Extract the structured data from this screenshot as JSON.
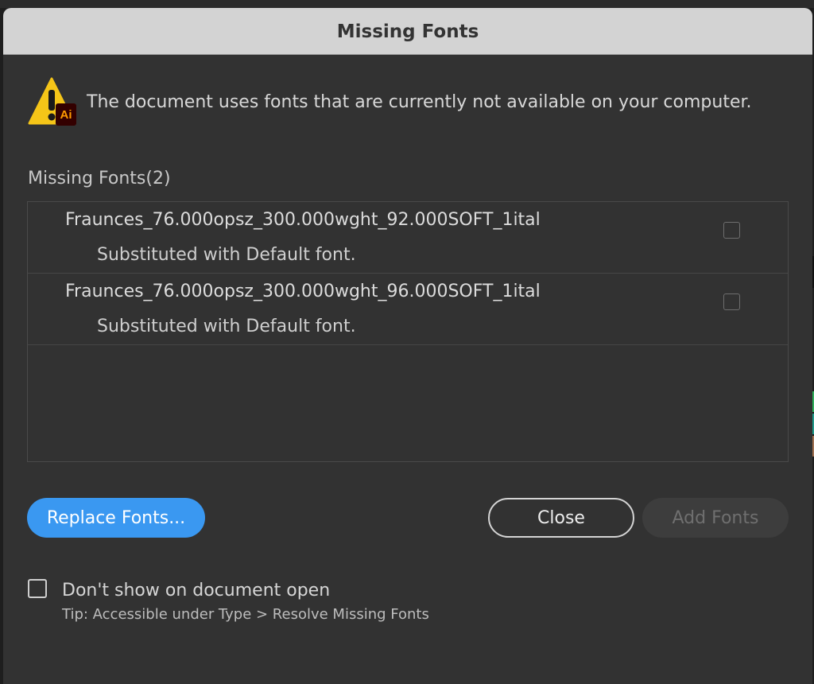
{
  "dialog": {
    "title": "Missing Fonts",
    "warning_text": "The document uses fonts that are currently not available on your computer.",
    "app_badge": "Ai",
    "section_label": "Missing Fonts(2)",
    "fonts": [
      {
        "name": "Fraunces_76.000opsz_300.000wght_92.000SOFT_1ital",
        "status": "Substituted with Default font.",
        "checked": false
      },
      {
        "name": "Fraunces_76.000opsz_300.000wght_96.000SOFT_1ital",
        "status": "Substituted with Default font.",
        "checked": false
      }
    ],
    "buttons": {
      "replace": "Replace Fonts...",
      "close": "Close",
      "add": "Add Fonts"
    },
    "dont_show": {
      "label": "Don't show on document open",
      "checked": false
    },
    "tip": "Tip: Accessible under Type > Resolve Missing Fonts"
  },
  "colors": {
    "accent": "#3a98f1",
    "dialog_bg": "#323232",
    "titlebar_bg": "#d3d3d3",
    "warning_yellow": "#f5c518",
    "badge_bg": "#330000",
    "badge_fg": "#ff9a00"
  }
}
